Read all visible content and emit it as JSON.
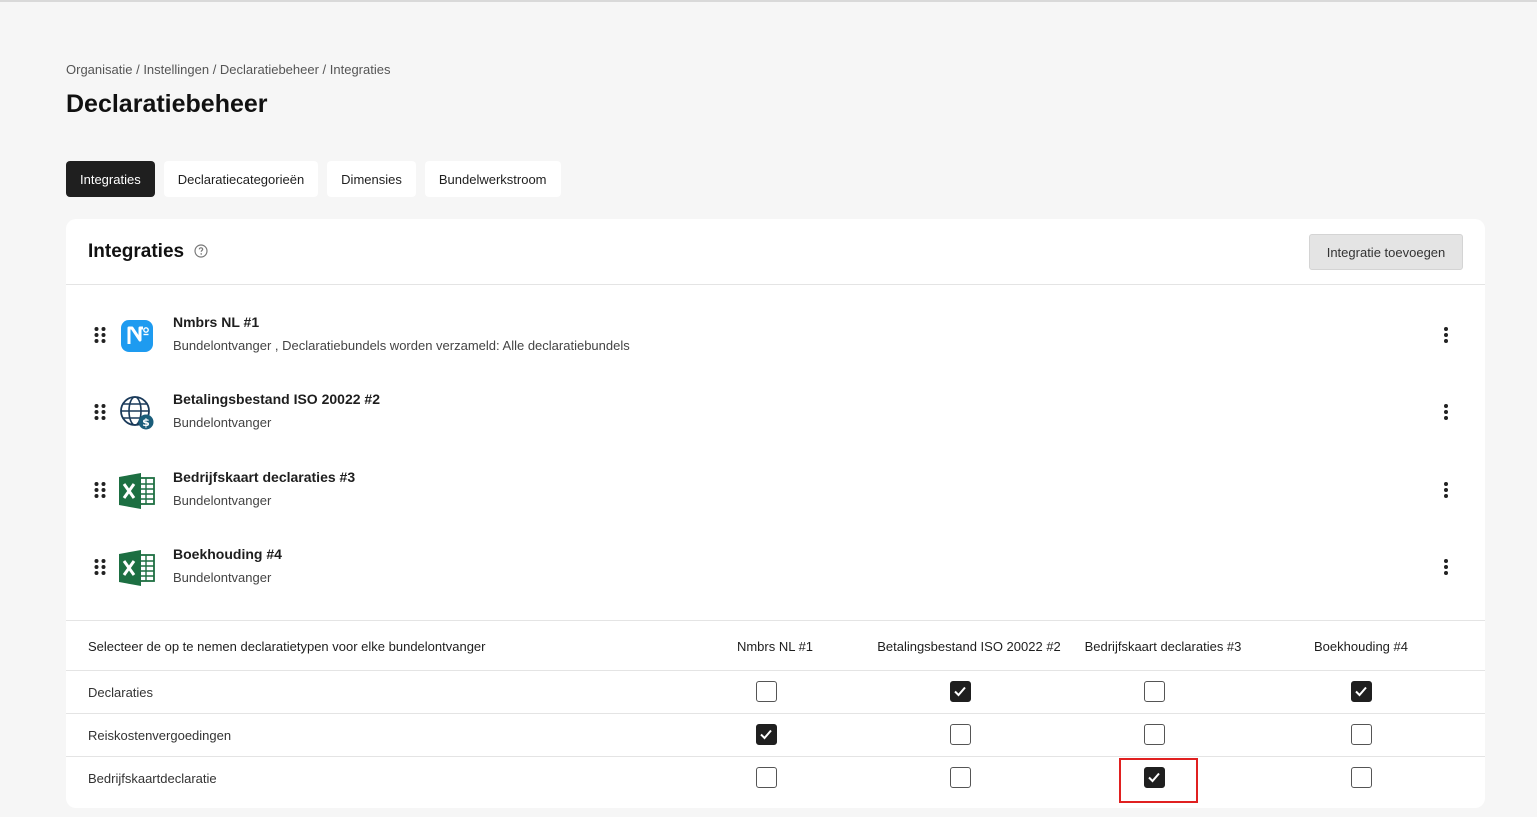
{
  "breadcrumb": "Organisatie / Instellingen / Declaratiebeheer / Integraties",
  "page_title": "Declaratiebeheer",
  "tabs": [
    {
      "label": "Integraties",
      "active": true
    },
    {
      "label": "Declaratiecategorieën",
      "active": false
    },
    {
      "label": "Dimensies",
      "active": false
    },
    {
      "label": "Bundelwerkstroom",
      "active": false
    }
  ],
  "card": {
    "title": "Integraties",
    "help_icon": "help-circle-icon",
    "add_button_label": "Integratie toevoegen"
  },
  "integrations": [
    {
      "title": "Nmbrs NL #1",
      "subtitle": "Bundelontvanger , Declaratiebundels worden verzameld: Alle declaratiebundels",
      "icon": "nmbrs-logo-icon"
    },
    {
      "title": "Betalingsbestand ISO 20022 #2",
      "subtitle": "Bundelontvanger",
      "icon": "globe-dollar-icon"
    },
    {
      "title": "Bedrijfskaart declaraties #3",
      "subtitle": "Bundelontvanger",
      "icon": "excel-icon"
    },
    {
      "title": "Boekhouding #4",
      "subtitle": "Bundelontvanger",
      "icon": "excel-icon"
    }
  ],
  "matrix": {
    "header_label": "Selecteer de op te nemen declaratietypen voor elke bundelontvanger",
    "columns": [
      "Nmbrs NL #1",
      "Betalingsbestand ISO 20022 #2",
      "Bedrijfskaart declaraties #3",
      "Boekhouding #4"
    ],
    "rows": [
      {
        "label": "Declaraties",
        "checked": [
          false,
          true,
          false,
          true
        ]
      },
      {
        "label": "Reiskostenvergoedingen",
        "checked": [
          true,
          false,
          false,
          false
        ]
      },
      {
        "label": "Bedrijfskaartdeclaratie",
        "checked": [
          false,
          false,
          true,
          false
        ]
      }
    ]
  },
  "colors": {
    "accent_dark": "#1f1f1f",
    "highlight_red": "#e02020",
    "nmbrs_blue": "#1e9bf0",
    "excel_green": "#1d6f42"
  }
}
